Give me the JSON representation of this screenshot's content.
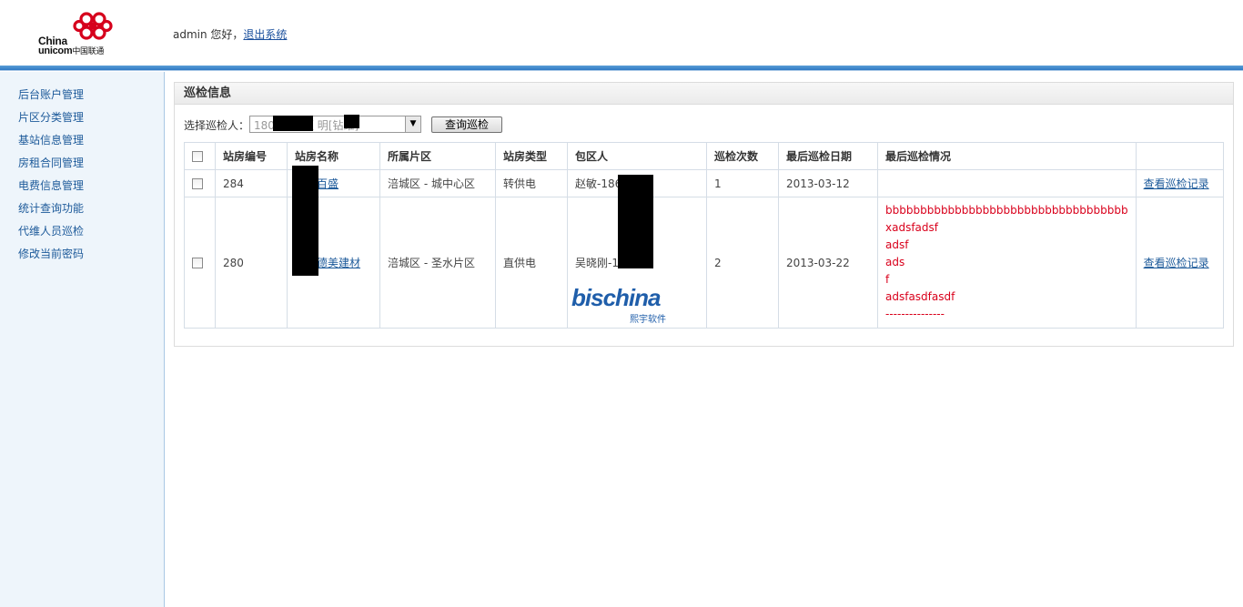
{
  "brand": {
    "name_en_1": "China",
    "name_en_2": "unicom",
    "name_cn": "中国联通",
    "colors": {
      "logo_red": "#d6001c",
      "header_bar": "#2f78c4"
    }
  },
  "header": {
    "greeting": "admin 您好，",
    "logout_label": "退出系统"
  },
  "sidebar": {
    "items": [
      {
        "label": "后台账户管理"
      },
      {
        "label": "片区分类管理"
      },
      {
        "label": "基站信息管理"
      },
      {
        "label": "房租合同管理"
      },
      {
        "label": "电费信息管理"
      },
      {
        "label": "统计查询功能"
      },
      {
        "label": "代维人员巡检"
      },
      {
        "label": "修改当前密码"
      }
    ]
  },
  "panel": {
    "title": "巡检信息",
    "filter_label": "选择巡检人：",
    "select_value": "180          15 - 须    明[钻维]",
    "query_button": "查询巡检"
  },
  "table": {
    "columns": [
      "站房编号",
      "站房名称",
      "所属片区",
      "站房类型",
      "包区人",
      "巡检次数",
      "最后巡检日期",
      "最后巡检情况"
    ],
    "rows": [
      {
        "id": "284",
        "name": "百盛",
        "area": "涪城区 - 城中心区",
        "type": "转供电",
        "owner": "赵敏-186         516",
        "count": "1",
        "last_date": "2013-03-12",
        "last_status": [],
        "action": "查看巡检记录"
      },
      {
        "id": "280",
        "name": "德美建材",
        "area": "涪城区 - 圣水片区",
        "type": "直供电",
        "owner": "吴晓刚-1          0567",
        "count": "2",
        "last_date": "2013-03-22",
        "last_status": [
          "bbbbbbbbbbbbbbbbbbbbbbbbbbbbbbbbbbb",
          "xadsfadsf",
          "adsf",
          "ads",
          "f",
          "adsfasdfasdf",
          "---------------"
        ],
        "action": "查看巡检记录"
      }
    ]
  },
  "watermark": {
    "part1": "bis",
    "part2": "china",
    "sub": "熙宇软件"
  }
}
